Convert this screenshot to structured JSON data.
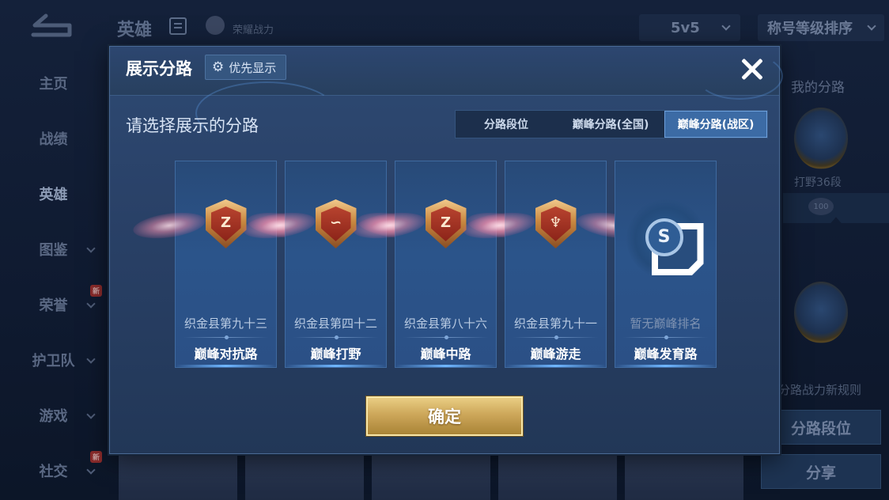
{
  "background": {
    "header": {
      "title": "英雄",
      "subtitle": "荣耀战力",
      "mode_select": "5v5",
      "sort_select": "称号等级排序"
    },
    "nav": [
      {
        "label": "主页",
        "has_arrow": false,
        "badge": ""
      },
      {
        "label": "战绩",
        "has_arrow": false,
        "badge": ""
      },
      {
        "label": "英雄",
        "has_arrow": false,
        "badge": "",
        "active": true
      },
      {
        "label": "图鉴",
        "has_arrow": true,
        "badge": ""
      },
      {
        "label": "荣誉",
        "has_arrow": true,
        "badge": "新"
      },
      {
        "label": "护卫队",
        "has_arrow": true,
        "badge": ""
      },
      {
        "label": "游戏",
        "has_arrow": true,
        "badge": ""
      },
      {
        "label": "社交",
        "has_arrow": true,
        "badge": "新"
      }
    ],
    "right_panel": {
      "title": "我的分路",
      "emblem_label": "打野36段",
      "ribbon_value": "100",
      "rule_link": "分路战力新规则",
      "lane_rank_button": "分路段位",
      "share_button": "分享"
    }
  },
  "modal": {
    "title": "展示分路",
    "priority_button": "优先显示",
    "subtitle": "请选择展示的分路",
    "tabs": [
      {
        "label": "分路段位",
        "active": false
      },
      {
        "label": "巅峰分路(全国)",
        "active": false
      },
      {
        "label": "巅峰分路(战区)",
        "active": true
      }
    ],
    "cards": [
      {
        "rank": "织金县第九十三",
        "lane": "巅峰对抗路",
        "glyph": "Z",
        "ranked": true
      },
      {
        "rank": "织金县第四十二",
        "lane": "巅峰打野",
        "glyph": "∽",
        "ranked": true
      },
      {
        "rank": "织金县第八十六",
        "lane": "巅峰中路",
        "glyph": "Z",
        "ranked": true
      },
      {
        "rank": "织金县第九十一",
        "lane": "巅峰游走",
        "glyph": "♆",
        "ranked": true
      },
      {
        "rank": "暂无巅峰排名",
        "lane": "巅峰发育路",
        "glyph": "S",
        "ranked": false
      }
    ],
    "confirm_button": "确定"
  },
  "colors": {
    "accent_tab": "#3c6ba5",
    "confirm_gold": "#cda75a",
    "modal_bg": "#2a4269"
  }
}
